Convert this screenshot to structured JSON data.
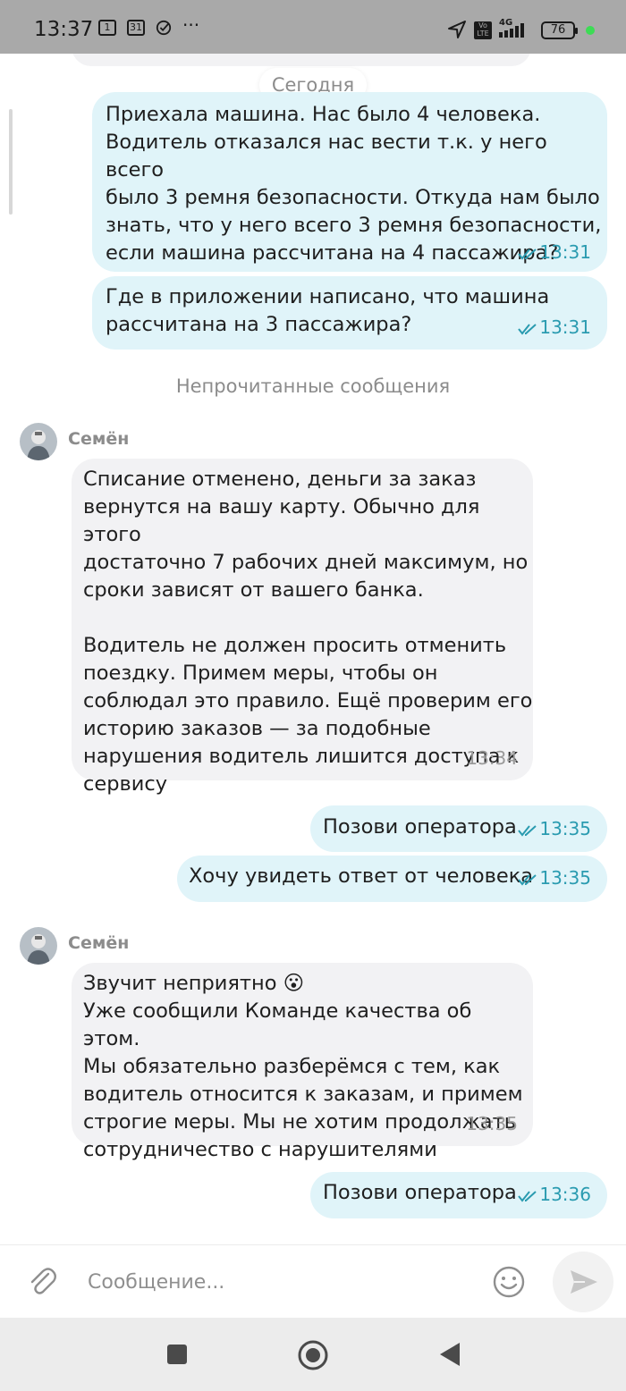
{
  "status_bar": {
    "time": "13:37",
    "notif_1": "1",
    "notif_2": "31",
    "more": "···",
    "network_volte": "Vo LTE",
    "network_type": "4G",
    "battery": "76",
    "icons": [
      "sim-notification-icon",
      "calendar-icon",
      "check-circle-icon",
      "more-dots-icon",
      "location-arrow-icon",
      "volte-icon",
      "signal-icon",
      "battery-icon"
    ]
  },
  "chat": {
    "date_separator": "Сегодня",
    "unread_separator": "Непрочитанные сообщения",
    "messages": [
      {
        "direction": "out",
        "text": "Приехала машина. Нас было 4 человека.\nВодитель отказался нас вести т.к. у него всего\nбыло 3 ремня безопасности. Откуда нам было\nзнать, что у него всего 3 ремня безопасности,\nесли машина рассчитана на 4 пассажира?",
        "time": "13:31",
        "read": true
      },
      {
        "direction": "out",
        "text": "Где в приложении написано, что машина\nрассчитана на 3 пассажира?",
        "time": "13:31",
        "read": true
      },
      {
        "direction": "in",
        "sender": "Семён",
        "text": "Списание отменено, деньги за заказ\nвернутся на вашу карту. Обычно для этого\nдостаточно 7 рабочих дней максимум, но\nсроки зависят от вашего банка.\n\nВодитель не должен просить отменить\nпоездку. Примем меры, чтобы он\nсоблюдал это правило. Ещё проверим его\nисторию заказов — за подобные\nнарушения водитель лишится доступа к\nсервису",
        "time": "13:34"
      },
      {
        "direction": "out",
        "text": "Позови оператора",
        "time": "13:35",
        "read": true
      },
      {
        "direction": "out",
        "text": "Хочу увидеть ответ от человека",
        "time": "13:35",
        "read": true
      },
      {
        "direction": "in",
        "sender": "Семён",
        "text": "Звучит неприятно 😮\nУже сообщили Команде качества об этом.\nМы обязательно разберёмся с тем, как\nводитель относится к заказам, и примем\nстрогие меры. Мы не хотим продолжать\nсотрудничество с нарушителями",
        "time": "13:35"
      },
      {
        "direction": "out",
        "text": "Позови оператора",
        "time": "13:36",
        "read": true
      }
    ]
  },
  "composer": {
    "placeholder": "Сообщение...",
    "value": "",
    "attach_icon": "paperclip-icon",
    "emoji_icon": "smile-icon",
    "send_icon": "send-icon"
  },
  "navigation": {
    "icons": [
      "recents-square-icon",
      "home-circle-icon",
      "back-triangle-icon"
    ]
  },
  "colors": {
    "status_bar_bg": "#a9a9a9",
    "outgoing_bubble": "#e0f4f9",
    "incoming_bubble": "#f2f2f4",
    "outgoing_meta": "#2a9bb0",
    "muted_text": "#8c8c8c",
    "nav_bar_bg": "#ececec"
  }
}
